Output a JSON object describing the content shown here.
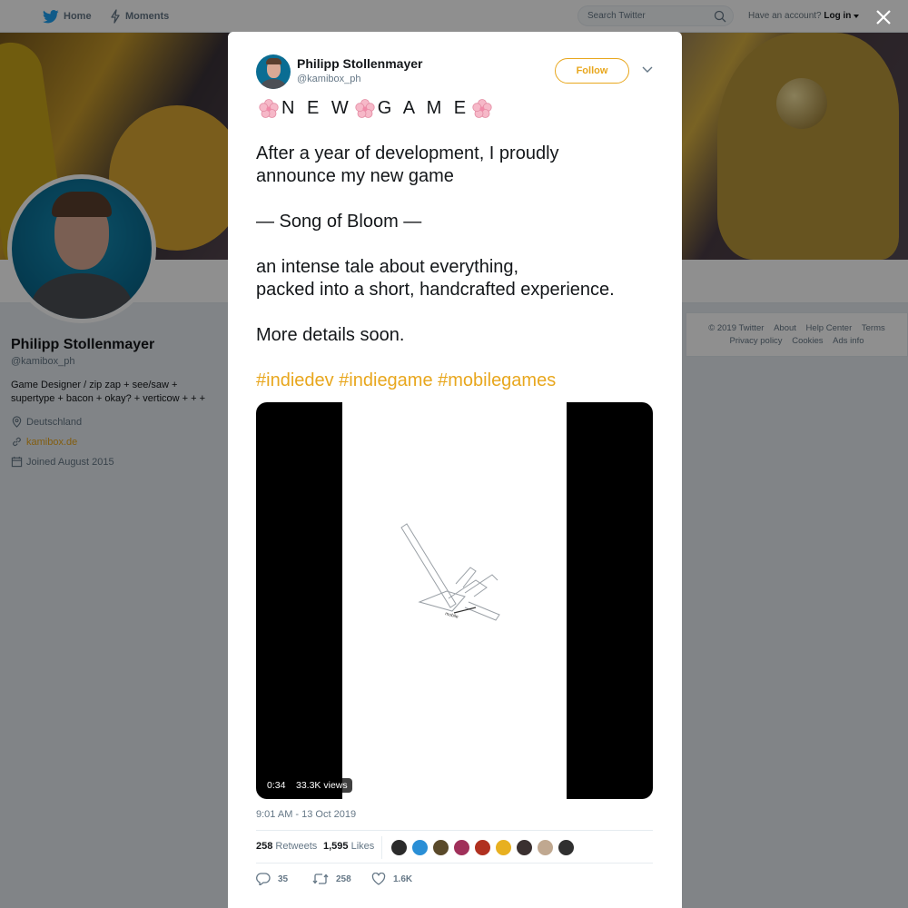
{
  "nav": {
    "home_label": "Home",
    "moments_label": "Moments",
    "search_placeholder": "Search Twitter",
    "account_prompt": "Have an account?",
    "login_label": "Log in"
  },
  "profile": {
    "name": "Philipp Stollenmayer",
    "handle": "@kamibox_ph",
    "bio": "Game Designer / zip zap + see/saw + supertype + bacon + okay? + verticow + + +",
    "location": "Deutschland",
    "website": "kamibox.de",
    "joined": "Joined August 2015"
  },
  "footer": {
    "links": [
      "© 2019 Twitter",
      "About",
      "Help Center",
      "Terms",
      "Privacy policy",
      "Cookies",
      "Ads info"
    ]
  },
  "tweet": {
    "author_name": "Philipp Stollenmayer",
    "author_handle": "@kamibox_ph",
    "follow_label": "Follow",
    "headline_parts": [
      "N E W",
      "G A M E"
    ],
    "lines": [
      "After a year of development, I proudly",
      "announce my new game",
      "",
      "— Song of Bloom —",
      "",
      "an intense tale about everything,",
      "packed into a short, handcrafted experience.",
      "",
      "More details soon.",
      ""
    ],
    "hashtags": "#indiedev #indiegame #mobilegames",
    "media": {
      "duration": "0:34",
      "views": "33.3K views",
      "art_label": "mobile"
    },
    "timestamp": "9:01 AM - 13 Oct 2019",
    "retweets_count": "258",
    "retweets_label": "Retweets",
    "likes_count": "1,595",
    "likes_label": "Likes",
    "liker_colors": [
      "#2b2b2b",
      "#2a8fd6",
      "#5a4a2a",
      "#a0305a",
      "#b03020",
      "#e8b020",
      "#3a3030",
      "#c0a890",
      "#303030"
    ],
    "actions": {
      "reply_count": "35",
      "retweet_count": "258",
      "like_count": "1.6K"
    }
  },
  "colors": {
    "accent": "#e8a71e",
    "twitter_blue": "#1da1f2",
    "muted_text": "#657786"
  }
}
